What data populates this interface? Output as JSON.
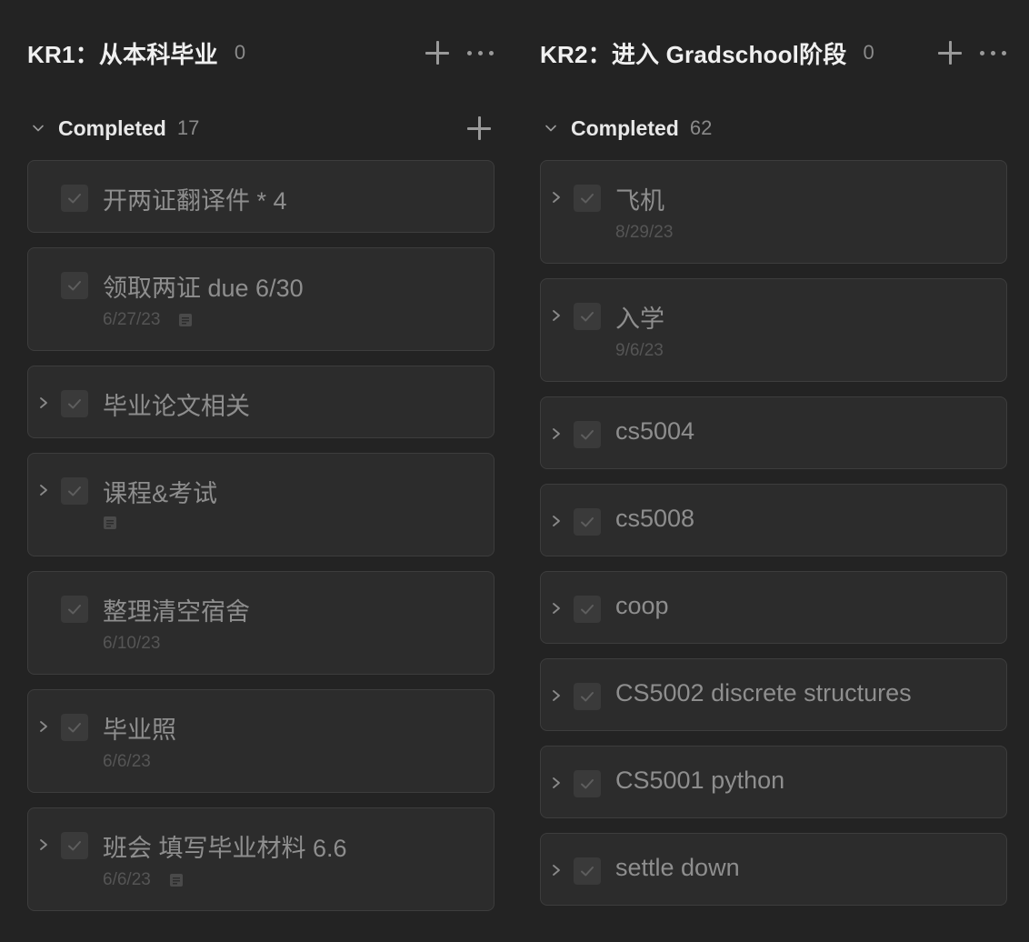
{
  "columns": [
    {
      "title": "KR1：从本科毕业",
      "count": "0",
      "section": {
        "title": "Completed",
        "count": "17"
      },
      "cards": [
        {
          "title": "开两证翻译件 * 4",
          "date": "",
          "has_children": false,
          "has_note": false
        },
        {
          "title": "领取两证 due 6/30",
          "date": "6/27/23",
          "has_children": false,
          "has_note": true
        },
        {
          "title": "毕业论文相关",
          "date": "",
          "has_children": true,
          "has_note": false
        },
        {
          "title": "课程&考试",
          "date": "",
          "has_children": true,
          "has_note": true
        },
        {
          "title": "整理清空宿舍",
          "date": "6/10/23",
          "has_children": false,
          "has_note": false
        },
        {
          "title": "毕业照",
          "date": "6/6/23",
          "has_children": true,
          "has_note": false
        },
        {
          "title": "班会 填写毕业材料 6.6",
          "date": "6/6/23",
          "has_children": true,
          "has_note": true
        }
      ]
    },
    {
      "title": "KR2：进入 Gradschool阶段",
      "count": "0",
      "section": {
        "title": "Completed",
        "count": "62"
      },
      "cards": [
        {
          "title": "飞机",
          "date": "8/29/23",
          "has_children": true,
          "has_note": false
        },
        {
          "title": "入学",
          "date": "9/6/23",
          "has_children": true,
          "has_note": false
        },
        {
          "title": "cs5004",
          "date": "",
          "has_children": true,
          "has_note": false
        },
        {
          "title": "cs5008",
          "date": "",
          "has_children": true,
          "has_note": false
        },
        {
          "title": "coop",
          "date": "",
          "has_children": true,
          "has_note": false
        },
        {
          "title": "CS5002 discrete structures",
          "date": "",
          "has_children": true,
          "has_note": false
        },
        {
          "title": "CS5001 python",
          "date": "",
          "has_children": true,
          "has_note": false
        },
        {
          "title": "settle down",
          "date": "",
          "has_children": true,
          "has_note": false
        }
      ]
    }
  ],
  "icons": {
    "column_add": "plus-icon",
    "column_more": "more-horizontal-icon",
    "section_toggle": "chevron-down-icon",
    "card_expand": "chevron-right-icon",
    "checkbox": "checkmark-icon",
    "note": "note-icon"
  },
  "colors": {
    "background": "#232323",
    "card": "#2c2c2c",
    "card_border": "#3d3d3d",
    "title_text": "#f0f0f0",
    "muted_text": "#8e8e8e",
    "date_text": "#555555"
  }
}
